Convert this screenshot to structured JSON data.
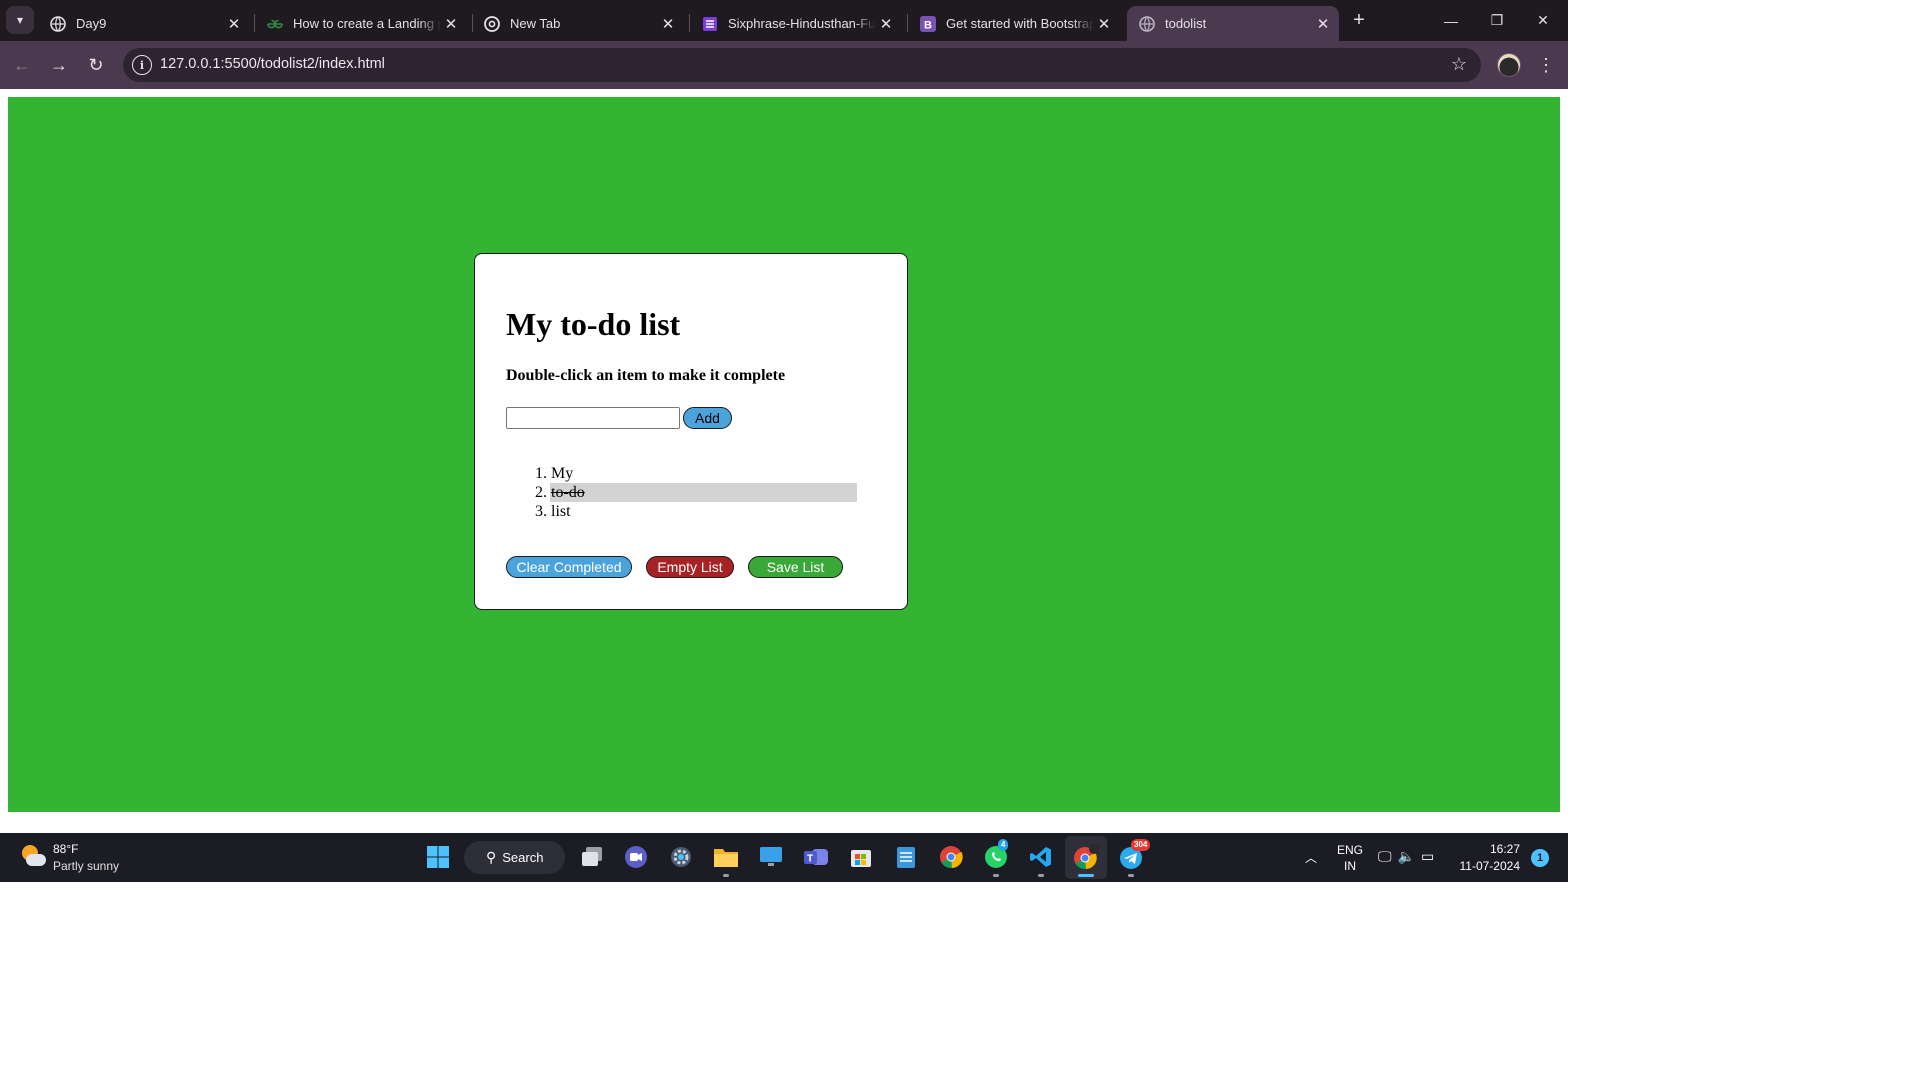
{
  "browser": {
    "tabs": [
      {
        "title": "Day9",
        "icon": "globe-icon",
        "active": false
      },
      {
        "title": "How to create a Landing page",
        "icon": "geeksforgeeks-icon",
        "active": false
      },
      {
        "title": "New Tab",
        "icon": "chrome-icon",
        "active": false
      },
      {
        "title": "Sixphrase-Hindusthan-Full",
        "icon": "form-icon",
        "active": false
      },
      {
        "title": "Get started with Bootstrap",
        "icon": "bootstrap-icon",
        "active": false
      },
      {
        "title": "todolist",
        "icon": "globe-icon",
        "active": true
      }
    ],
    "url": "127.0.0.1:5500/todolist2/index.html"
  },
  "page": {
    "background_color": "#33b533",
    "heading": "My to-do list",
    "instruction": "Double-click an item to make it complete",
    "input_value": "",
    "add_label": "Add",
    "items": [
      {
        "number": "1.",
        "text": "My",
        "completed": false
      },
      {
        "number": "2.",
        "text": "to-do",
        "completed": true
      },
      {
        "number": "3.",
        "text": "list",
        "completed": false
      }
    ],
    "buttons": {
      "clear_completed": "Clear Completed",
      "empty_list": "Empty List",
      "save_list": "Save List"
    },
    "colors": {
      "add": "#4ba3db",
      "clear": "#4ba3db",
      "empty": "#a62224",
      "save": "#3aa838"
    }
  },
  "taskbar": {
    "weather_temp": "88°F",
    "weather_desc": "Partly sunny",
    "search_label": "Search",
    "whatsapp_badge": "4",
    "telegram_badge": "304",
    "lang_top": "ENG",
    "lang_bottom": "IN",
    "time": "16:27",
    "date": "11-07-2024",
    "notification_count": "1"
  }
}
